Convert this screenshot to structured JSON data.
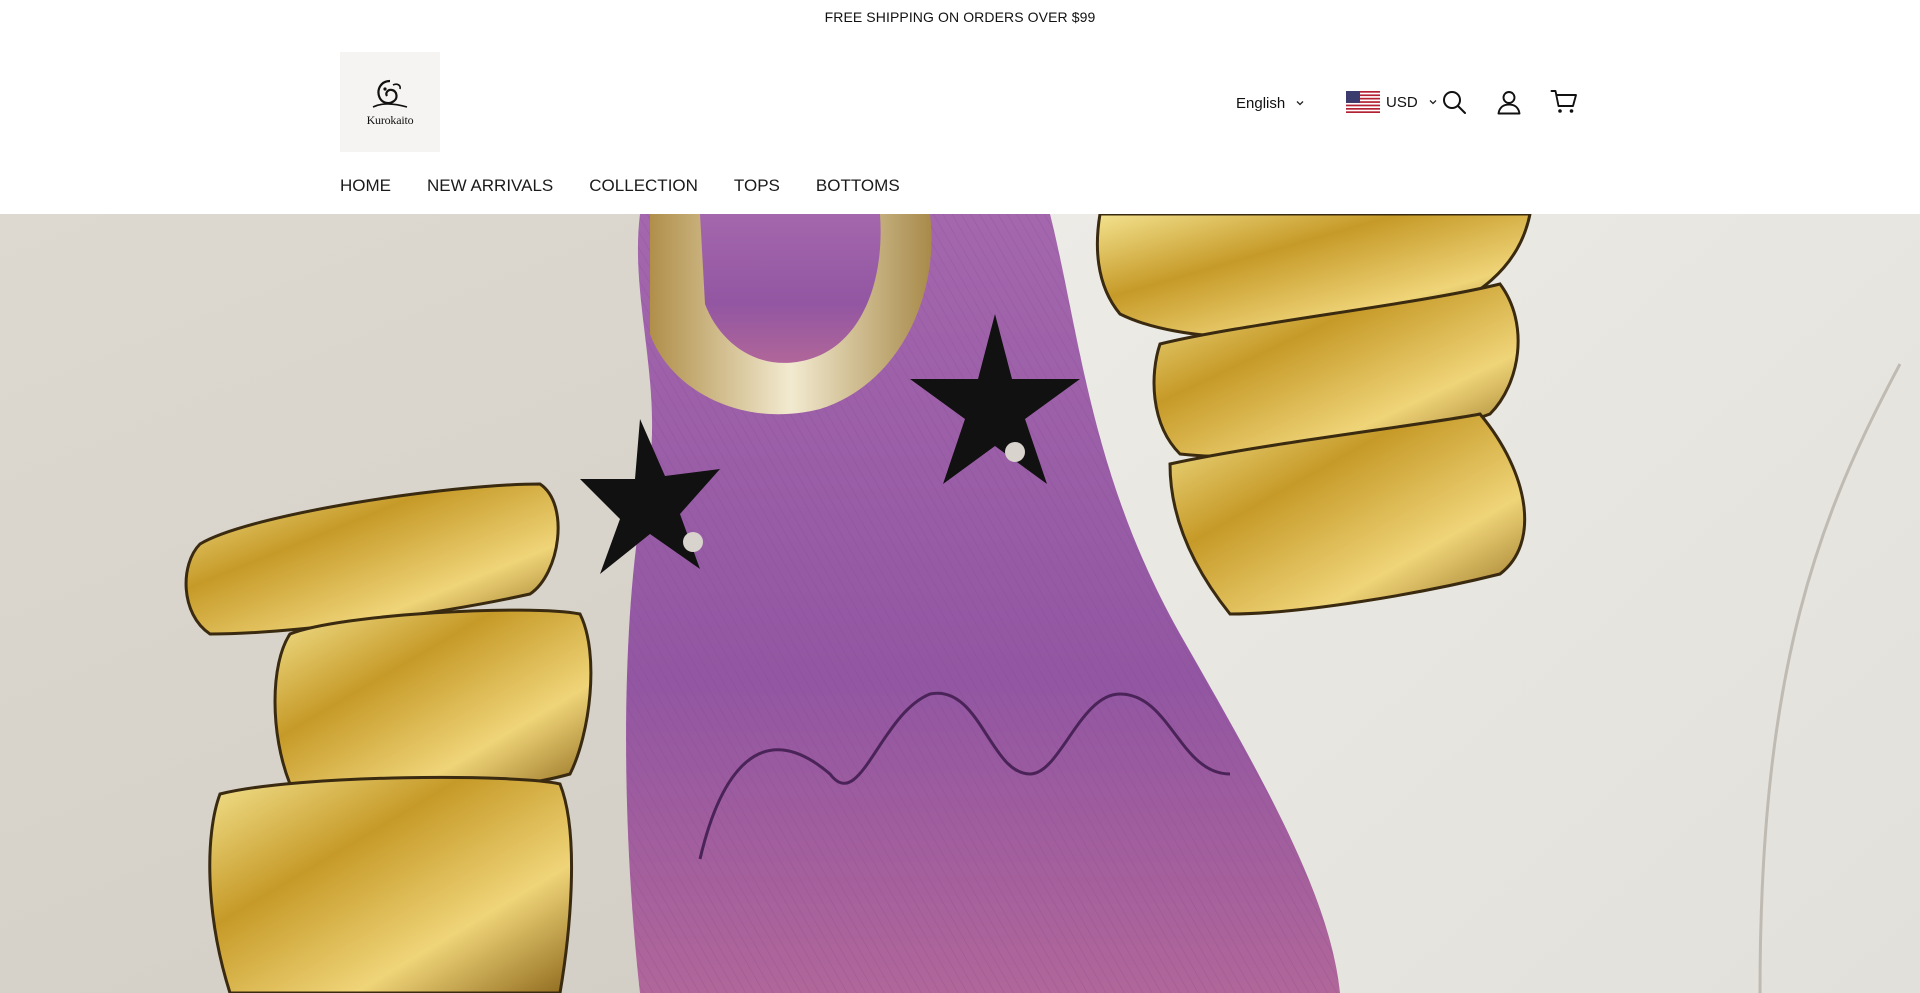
{
  "announcement": {
    "text": "FREE SHIPPING ON ORDERS OVER $99"
  },
  "logo": {
    "text": "Kurokaito",
    "icon": "brand-logo-icon"
  },
  "header": {
    "language": {
      "label": "English",
      "icon": "chevron-down-icon"
    },
    "currency": {
      "label": "USD",
      "flag_icon": "us-flag-icon",
      "icon": "chevron-down-icon"
    },
    "icons": [
      "search-icon",
      "account-icon",
      "cart-icon"
    ]
  },
  "nav": {
    "items": [
      {
        "label": "HOME"
      },
      {
        "label": "NEW ARRIVALS"
      },
      {
        "label": "COLLECTION"
      },
      {
        "label": "TOPS"
      },
      {
        "label": "BOTTOMS"
      }
    ]
  },
  "hero": {
    "image": "product-closeup-image",
    "colors": {
      "canvas": "#e8e5df",
      "denim": "#9a5aa6",
      "gold": "#c9a23a",
      "star": "#111111"
    }
  }
}
